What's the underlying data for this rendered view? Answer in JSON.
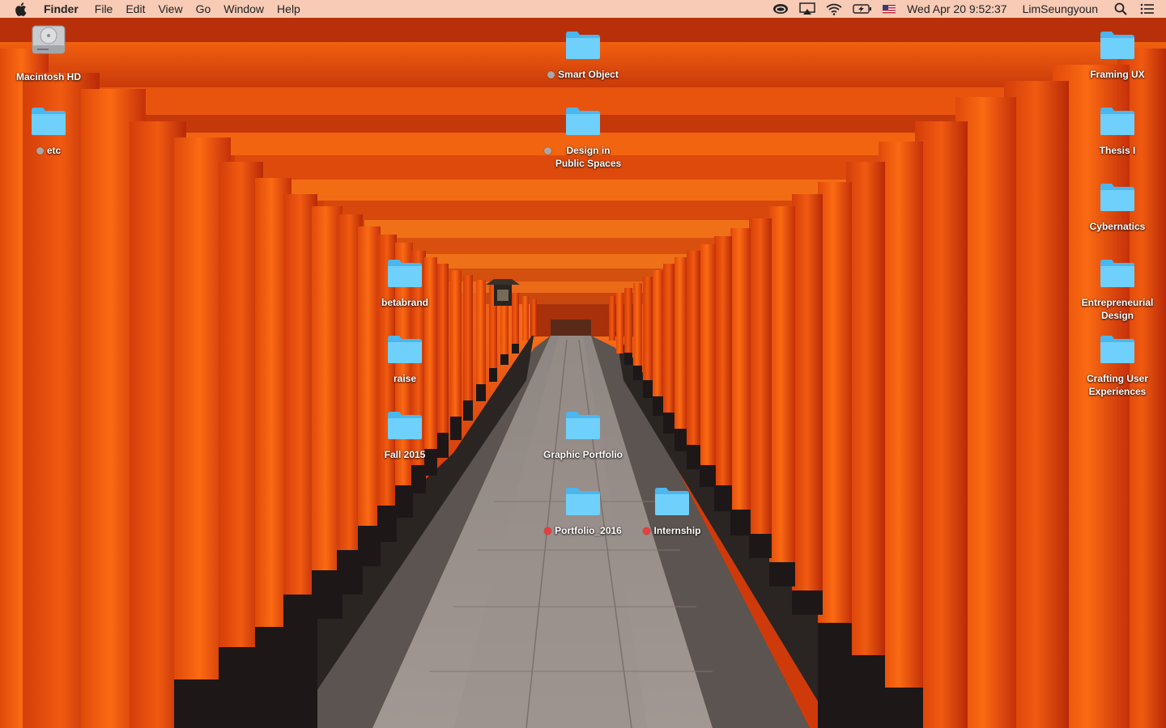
{
  "menubar": {
    "apple_icon": "apple-logo-icon",
    "app_name": "Finder",
    "menus": [
      "File",
      "Edit",
      "View",
      "Go",
      "Window",
      "Help"
    ],
    "status_icons": [
      "creative-cloud-icon",
      "airplay-icon",
      "wifi-icon",
      "battery-charging-icon",
      "us-flag-input-icon"
    ],
    "clock": "Wed Apr 20  9:52:37",
    "user": "LimSeungyoun",
    "right_icons": [
      "spotlight-search-icon",
      "notification-center-icon"
    ]
  },
  "desktop": {
    "wallpaper": "torii-gate-tunnel",
    "icons": [
      {
        "label": "Macintosh HD",
        "kind": "drive",
        "tag": ""
      },
      {
        "label": "etc",
        "kind": "folder",
        "tag": "gray"
      },
      {
        "label": "Smart Object",
        "kind": "folder",
        "tag": "gray"
      },
      {
        "label": "Design in Public Spaces",
        "kind": "folder",
        "tag": "gray"
      },
      {
        "label": "betabrand",
        "kind": "folder",
        "tag": ""
      },
      {
        "label": "raise",
        "kind": "folder",
        "tag": ""
      },
      {
        "label": "Fall 2015",
        "kind": "folder",
        "tag": ""
      },
      {
        "label": "Graphic Portfolio",
        "kind": "folder",
        "tag": ""
      },
      {
        "label": "Portfolio_2016",
        "kind": "folder",
        "tag": "red"
      },
      {
        "label": "Internship",
        "kind": "folder",
        "tag": "red"
      },
      {
        "label": "Framing UX",
        "kind": "folder",
        "tag": ""
      },
      {
        "label": "Thesis I",
        "kind": "folder",
        "tag": ""
      },
      {
        "label": "Cybernatics",
        "kind": "folder",
        "tag": ""
      },
      {
        "label": "Entrepreneurial Design",
        "kind": "folder",
        "tag": ""
      },
      {
        "label": "Crafting User Experiences",
        "kind": "folder",
        "tag": ""
      }
    ]
  },
  "colors": {
    "folder": "#5ec8f8",
    "tag_gray": "#a8a8a8",
    "tag_red": "#ef3b3b",
    "menubar_bg": "#fad6c4"
  }
}
